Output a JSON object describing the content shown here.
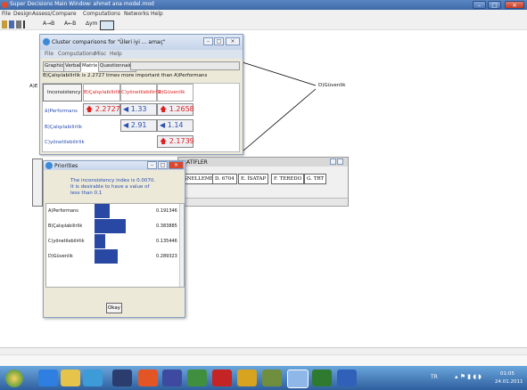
{
  "window": {
    "title": "Super Decisions Main Window: ahmet ana model.mod"
  },
  "menubar": [
    "File",
    "Design",
    "Assess/Compare",
    "Computations",
    "Networks",
    "Help"
  ],
  "toolbar": {
    "abc1": "A→B",
    "abc2": "A←B",
    "sym": "∆ym"
  },
  "canvas": {
    "node_guvenlik": "D)Güvenlik",
    "left_node_fragment": "A)E"
  },
  "cluster_window": {
    "title": "Cluster comparisons for \"Üleri iyi ... amaç\"",
    "menu": [
      "File",
      "Computations",
      "Misc",
      "Help"
    ],
    "tabs": [
      "Graphic",
      "Verbal",
      "Matrix",
      "Questionnaire"
    ],
    "statement": "B)Çalışılabilirlik is 2.2727 times more important than  A)Performans",
    "matrix": {
      "corner": "Inconsistency",
      "col_headers": [
        "B)Çalışılabilirlik",
        "C)yönetilebilirlik",
        "D)Güvenlik"
      ],
      "row_headers": [
        "â)Performans",
        "B)Çalışılabilirlik",
        "C)yönetilebilirlik"
      ],
      "cells": [
        [
          "2.2727",
          "1.33",
          "1.2658"
        ],
        [
          "",
          "2.91",
          "1.14"
        ],
        [
          "",
          "",
          "2.1739"
        ]
      ]
    }
  },
  "networks_window": {
    "header": "ATİFLER",
    "buttons": [
      "ŞNELLEME",
      "D. 6704",
      "E. İSATAP",
      "F. TEREDO",
      "G. TRT"
    ]
  },
  "priorities": {
    "title": "Priorities",
    "message": "The inconsistency index is 0.0070.  It is desirable to have a value of less than 0.1",
    "rows": [
      {
        "label": "A)Performans",
        "value": "0.191346",
        "weight": 0.191346
      },
      {
        "label": "B)Çalışılabilirlik",
        "value": "0.383885",
        "weight": 0.383885
      },
      {
        "label": "C)yönetilebilirlik",
        "value": "0.135446",
        "weight": 0.135446
      },
      {
        "label": "D)Güvenlik",
        "value": "0.289323",
        "weight": 0.289323
      }
    ],
    "ok_label": "Okay"
  },
  "taskbar": {
    "lang": "TR",
    "time": "01:05",
    "date": "24.01.2011"
  },
  "colors": {
    "titlebar": "#3f6aa8",
    "bar_fill": "#2848a4",
    "taskbar": "#2f5f9e",
    "red_arrow": "#e11b1b"
  }
}
